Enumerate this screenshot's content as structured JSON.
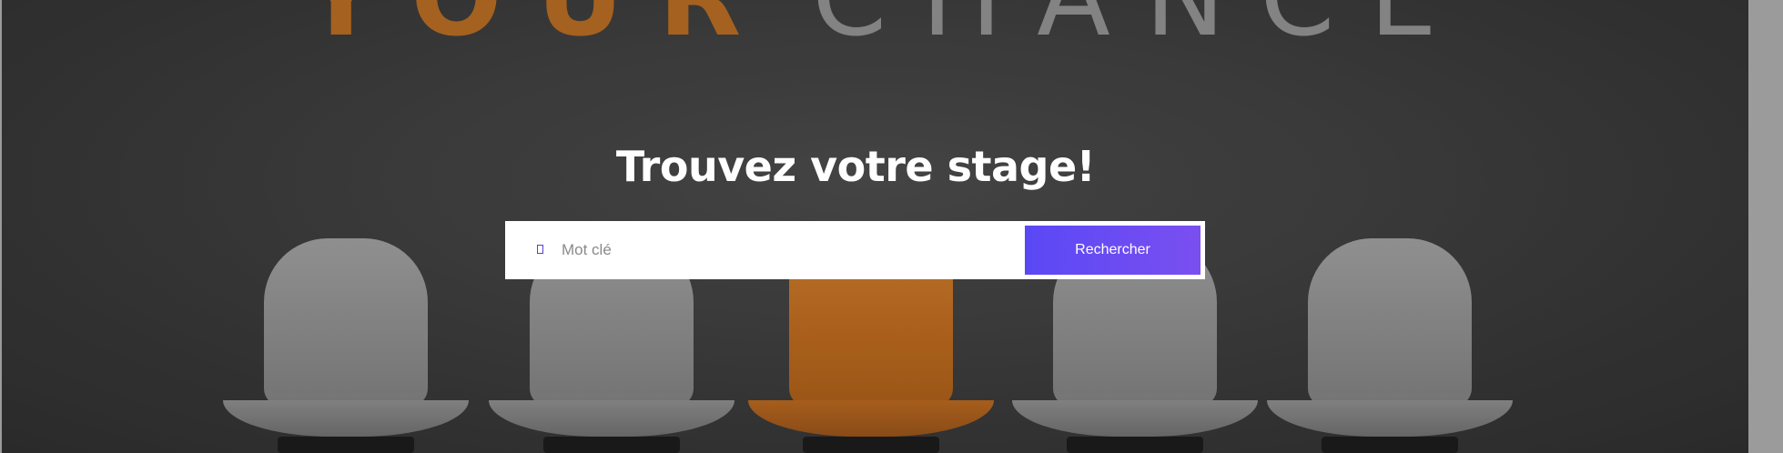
{
  "hero": {
    "wall_text_left": "YOUR",
    "wall_text_right": "CHANCE",
    "headline": "Trouvez votre stage!"
  },
  "search": {
    "icon": "search-icon",
    "placeholder": "Mot clé",
    "value": "",
    "button_label": "Rechercher"
  },
  "colors": {
    "accent": "#5a48f5",
    "accent_end": "#7a4ff0",
    "chair_orange": "#c97a2c",
    "background": "#3a3a3a"
  }
}
